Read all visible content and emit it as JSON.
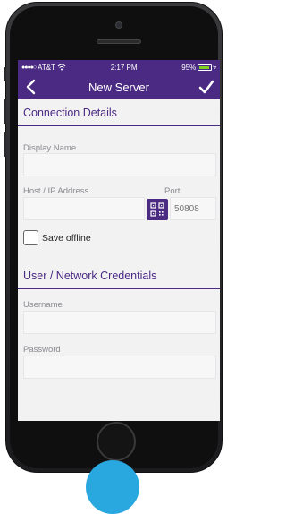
{
  "status_bar": {
    "carrier": "AT&T",
    "time": "2:17 PM",
    "battery": "95%",
    "battery_level": 0.95
  },
  "nav": {
    "title": "New Server",
    "back_icon": "chevron-left-icon",
    "done_icon": "checkmark-icon"
  },
  "connection": {
    "header": "Connection Details",
    "display_name_label": "Display Name",
    "display_name_value": "",
    "host_label": "Host / IP Address",
    "host_value": "",
    "port_label": "Port",
    "port_placeholder": "50808",
    "qr_icon": "qr-code-icon",
    "save_offline_label": "Save offline",
    "save_offline_checked": false
  },
  "credentials": {
    "header": "User / Network Credentials",
    "username_label": "Username",
    "username_value": "",
    "password_label": "Password",
    "password_value": ""
  },
  "colors": {
    "brand": "#4b2a83",
    "battery_fill": "#7ed321",
    "accent_circle": "#29a8e0"
  }
}
